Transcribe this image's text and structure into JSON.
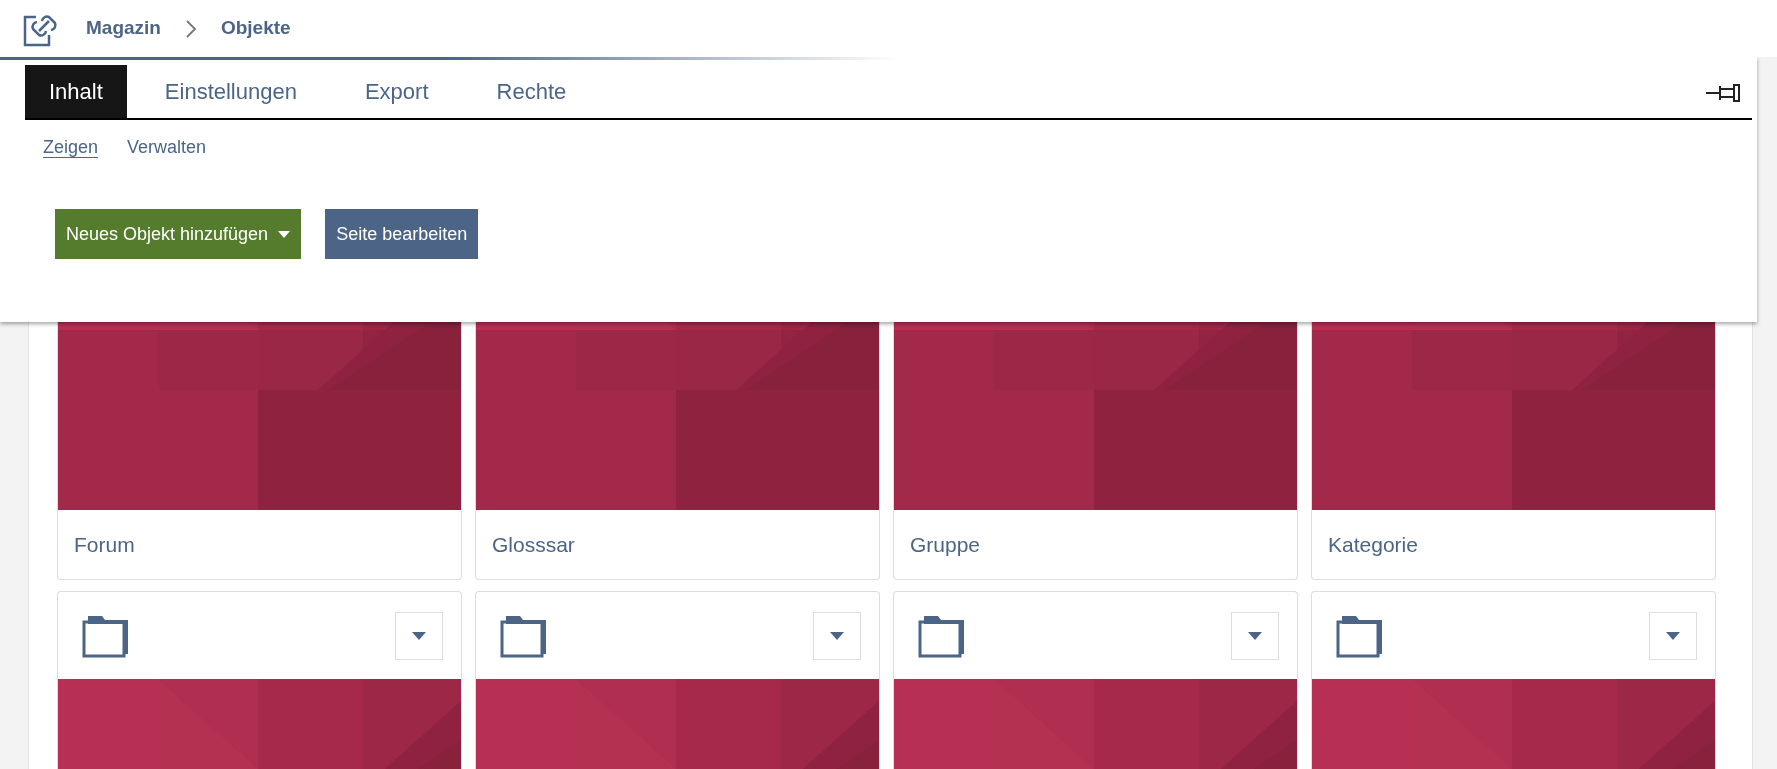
{
  "breadcrumbs": [
    {
      "label": "Magazin"
    },
    {
      "label": "Objekte"
    }
  ],
  "tabs": [
    {
      "label": "Inhalt",
      "selected": true
    },
    {
      "label": "Einstellungen",
      "selected": false
    },
    {
      "label": "Export",
      "selected": false
    },
    {
      "label": "Rechte",
      "selected": false
    }
  ],
  "subtabs": [
    {
      "label": "Zeigen",
      "selected": true
    },
    {
      "label": "Verwalten",
      "selected": false
    }
  ],
  "buttons": [
    {
      "label": "Neues Objekt hinzufügen",
      "kind": "dropdown"
    },
    {
      "label": "Seite bearbeiten",
      "kind": "plain"
    }
  ],
  "rows": [
    {
      "kind": "cut_top",
      "cards": [
        {
          "title": "Forum"
        },
        {
          "title": "Glosssar"
        },
        {
          "title": "Gruppe"
        },
        {
          "title": "Kategorie"
        }
      ]
    },
    {
      "kind": "cut_bottom",
      "cards": [
        {
          "kind": "folder"
        },
        {
          "kind": "folder"
        },
        {
          "kind": "folder"
        },
        {
          "kind": "folder"
        }
      ]
    }
  ]
}
